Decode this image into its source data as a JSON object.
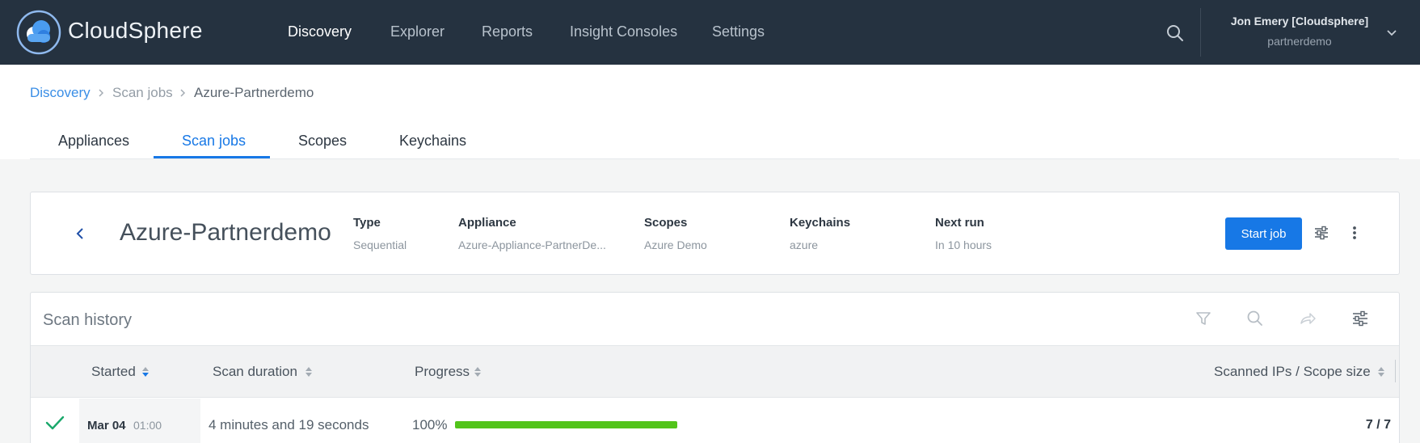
{
  "app": {
    "brand": "CloudSphere",
    "nav": [
      "Discovery",
      "Explorer",
      "Reports",
      "Insight Consoles",
      "Settings"
    ],
    "active_nav": "Discovery",
    "user_name": "Jon Emery [Cloudsphere]",
    "user_org": "partnerdemo",
    "icons": {
      "logo": "cloudsphere-logo-icon",
      "search": "search-icon",
      "user_menu": "chevron-down-icon"
    }
  },
  "breadcrumb": [
    "Discovery",
    "Scan jobs",
    "Azure-Partnerdemo"
  ],
  "tabs": [
    "Appliances",
    "Scan jobs",
    "Scopes",
    "Keychains"
  ],
  "active_tab": "Scan jobs",
  "job": {
    "title": "Azure-Partnerdemo",
    "meta": [
      {
        "label": "Type",
        "value": "Sequential"
      },
      {
        "label": "Appliance",
        "value": "Azure-Appliance-PartnerDe..."
      },
      {
        "label": "Scopes",
        "value": "Azure Demo"
      },
      {
        "label": "Keychains",
        "value": "azure"
      },
      {
        "label": "Next run",
        "value": "In 10 hours"
      }
    ],
    "start_button": "Start job"
  },
  "history": {
    "title": "Scan history",
    "tool_icons": [
      "filter-icon",
      "search-icon",
      "share-icon",
      "column-settings-icon"
    ],
    "columns": [
      "Started",
      "Scan duration",
      "Progress",
      "Scanned IPs / Scope size"
    ],
    "sorted_column": "Started",
    "rows": [
      {
        "status": "success",
        "date": "Mar 04",
        "time": "01:00",
        "duration": "4 minutes and 19 seconds",
        "progress_label": "100%",
        "progress": 1.0,
        "ips": "7 / 7"
      }
    ]
  },
  "colors": {
    "topbar": "#253240",
    "accent": "#1778e6",
    "success": "#52c41a",
    "check": "#1aa86b"
  }
}
